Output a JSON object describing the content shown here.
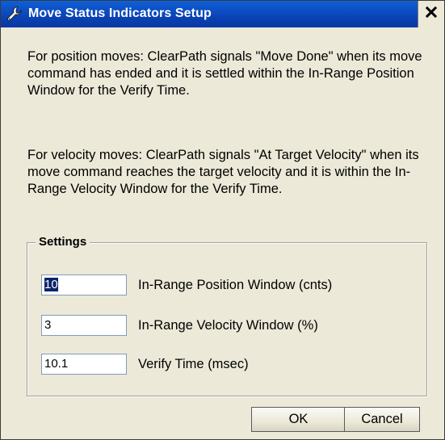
{
  "window": {
    "title": "Move Status Indicators Setup",
    "close_label": "×"
  },
  "description": {
    "paragraph_position": "For position moves: ClearPath signals \"Move Done\" when its move command has ended and it is settled within the In-Range Position Window for the Verify Time.",
    "paragraph_velocity": "For velocity moves: ClearPath signals \"At Target Velocity\" when its move command reaches the target velocity and it is within the In-Range Velocity Window for the Verify Time."
  },
  "settings": {
    "legend": "Settings",
    "fields": [
      {
        "value": "10",
        "label": "In-Range Position Window (cnts)"
      },
      {
        "value": "3",
        "label": "In-Range Velocity Window (%)"
      },
      {
        "value": "10.1",
        "label": "Verify Time (msec)"
      }
    ]
  },
  "buttons": {
    "ok_label": "OK",
    "cancel_label": "Cancel"
  },
  "icons": {
    "title_icon": "wrench-icon",
    "close_icon": "close-icon"
  },
  "colors": {
    "titlebar": "#0a3fb0",
    "dialog_background": "#ece9d8",
    "selection": "#0a246a"
  }
}
